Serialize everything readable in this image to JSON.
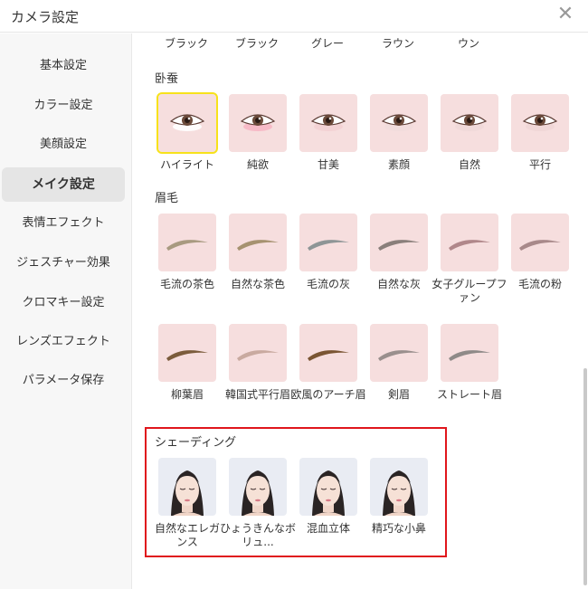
{
  "window": {
    "title": "カメラ設定",
    "close_icon": "close-icon"
  },
  "sidebar": {
    "items": [
      {
        "label": "基本設定",
        "active": false
      },
      {
        "label": "カラー設定",
        "active": false
      },
      {
        "label": "美顔設定",
        "active": false
      },
      {
        "label": "メイク設定",
        "active": true
      },
      {
        "label": "表情エフェクト",
        "active": false
      },
      {
        "label": "ジェスチャー効果",
        "active": false
      },
      {
        "label": "クロマキー設定",
        "active": false
      },
      {
        "label": "レンズエフェクト",
        "active": false
      },
      {
        "label": "パラメータ保存",
        "active": false
      }
    ]
  },
  "top_partial": {
    "items": [
      "ブラック",
      "ブラック",
      "グレー",
      "ラウン",
      "ウン"
    ]
  },
  "eyebag": {
    "label": "卧蚕",
    "items": [
      {
        "label": "ハイライト",
        "selected": true,
        "tint": "#ffffff"
      },
      {
        "label": "純欲",
        "selected": false,
        "tint": "#f7b6c4"
      },
      {
        "label": "甘美",
        "selected": false,
        "tint": "#f3d0d3"
      },
      {
        "label": "素顔",
        "selected": false,
        "tint": "#f1dcdc"
      },
      {
        "label": "自然",
        "selected": false,
        "tint": "#f0d8d8"
      },
      {
        "label": "平行",
        "selected": false,
        "tint": "#efd6d6"
      }
    ]
  },
  "eyebrow": {
    "label": "眉毛",
    "items": [
      {
        "label": "毛流の茶色",
        "color": "#a89a80"
      },
      {
        "label": "自然な茶色",
        "color": "#a69270"
      },
      {
        "label": "毛流の灰",
        "color": "#8e9596"
      },
      {
        "label": "自然な灰",
        "color": "#8a7f7b"
      },
      {
        "label": "女子グループファン",
        "color": "#b0878a"
      },
      {
        "label": "毛流の粉",
        "color": "#a8898a"
      },
      {
        "label": "柳葉眉",
        "color": "#7b5c3c"
      },
      {
        "label": "韓国式平行眉",
        "color": "#c9aaa0"
      },
      {
        "label": "欧風のアーチ眉",
        "color": "#7a5533"
      },
      {
        "label": "剣眉",
        "color": "#9a8f8d"
      },
      {
        "label": "ストレート眉",
        "color": "#8f8a88"
      }
    ]
  },
  "shading": {
    "label": "シェーディング",
    "items": [
      {
        "label": "自然なエレガンス"
      },
      {
        "label": "ひょうきんなボリュ..."
      },
      {
        "label": "混血立体"
      },
      {
        "label": "精巧な小鼻"
      }
    ]
  },
  "colors": {
    "highlight_border": "#e0161c",
    "selected_border": "#f7e21b",
    "thumb_bg": "#f6dede"
  }
}
